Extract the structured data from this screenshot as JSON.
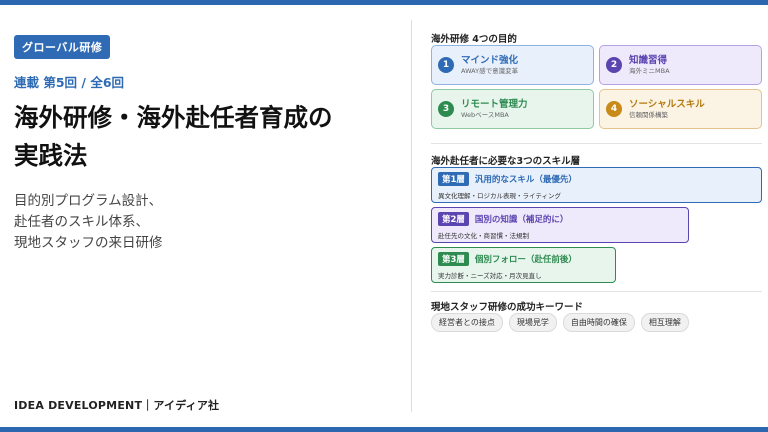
{
  "colors": {
    "accent": "#2f6bb4",
    "purple": "#5b45b0",
    "green": "#2e8b50",
    "gold": "#c88a18"
  },
  "left": {
    "tag": "グローバル研修",
    "series": "連載  第5回 / 全6回",
    "title_line1": "海外研修・海外赴任者育成の",
    "title_line2": "実践法",
    "subtitle_lines": [
      "目的別プログラム設計、",
      "赴任者のスキル体系、",
      "現地スタッフの来日研修"
    ],
    "footer": "IDEA DEVELOPMENT｜アイディア社"
  },
  "goals": {
    "title": "海外研修 4つの目的",
    "items": [
      {
        "num": "1",
        "name": "マインド強化",
        "sub": "AWAY感で意識変革"
      },
      {
        "num": "2",
        "name": "知識習得",
        "sub": "海外ミニMBA"
      },
      {
        "num": "3",
        "name": "リモート管理力",
        "sub": "WebベースMBA"
      },
      {
        "num": "4",
        "name": "ソーシャルスキル",
        "sub": "信頼関係構築"
      }
    ]
  },
  "skills": {
    "title": "海外赴任者に必要な3つのスキル層",
    "layers": [
      {
        "badge": "第1層",
        "name": "汎用的なスキル（最優先）",
        "sub": "異文化理解・ロジカル表現・ライティング"
      },
      {
        "badge": "第2層",
        "name": "国別の知識（補足的に）",
        "sub": "赴任先の文化・商習慣・法規制"
      },
      {
        "badge": "第3層",
        "name": "個別フォロー（赴任前後）",
        "sub": "実力診断・ニーズ対応・月次見直し"
      }
    ]
  },
  "keywords": {
    "title": "現地スタッフ研修の成功キーワード",
    "items": [
      "経営者との接点",
      "現場見学",
      "自由時間の確保",
      "相互理解"
    ]
  }
}
